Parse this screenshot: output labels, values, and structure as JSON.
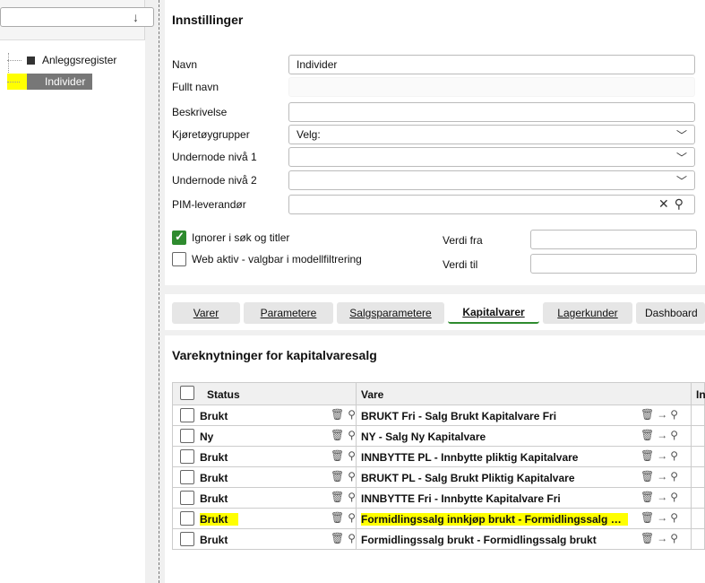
{
  "tree": {
    "search_value": "",
    "down_arrow": "↓",
    "items": [
      {
        "label": "Anleggsregister",
        "selected": false
      },
      {
        "label": "Individer",
        "selected": true
      }
    ]
  },
  "settings": {
    "title": "Innstillinger",
    "fields": [
      {
        "label": "Navn",
        "value": "Individer"
      },
      {
        "label": "Fullt navn",
        "value": ""
      },
      {
        "label": "Beskrivelse",
        "value": ""
      },
      {
        "label": "Kjøretøygrupper",
        "value": "Velg:"
      },
      {
        "label": "Undernode nivå 1",
        "value": ""
      },
      {
        "label": "Undernode nivå 2",
        "value": ""
      },
      {
        "label": "PIM-leverandør",
        "value": ""
      }
    ],
    "checkboxes": [
      {
        "label": "Ignorer i søk og titler",
        "checked": true
      },
      {
        "label": "Web aktiv - valgbar i modellfiltrering",
        "checked": false
      }
    ],
    "verdi_fra_label": "Verdi fra",
    "verdi_til_label": "Verdi til"
  },
  "tabs": [
    {
      "label": "Varer"
    },
    {
      "label": "Parametere"
    },
    {
      "label": "Salgsparametere"
    },
    {
      "label": "Kapitalvarer",
      "active": true
    },
    {
      "label": "Lagerkunder"
    },
    {
      "label": "Dashboard"
    }
  ],
  "table": {
    "title": "Vareknytninger for kapitalvaresalg",
    "headers": {
      "status": "Status",
      "vare": "Vare",
      "extra": "In"
    },
    "rows": [
      {
        "status": "Brukt",
        "vare": "BRUKT Fri - Salg Brukt Kapitalvare Fri"
      },
      {
        "status": "Ny",
        "vare": "NY - Salg Ny Kapitalvare"
      },
      {
        "status": "Brukt",
        "vare": "INNBYTTE PL - Innbytte pliktig Kapitalvare"
      },
      {
        "status": "Brukt",
        "vare": "BRUKT PL - Salg Brukt Pliktig Kapitalvare"
      },
      {
        "status": "Brukt",
        "vare": "INNBYTTE Fri - Innbytte Kapitalvare Fri"
      },
      {
        "status": "Brukt",
        "vare": "Formidlingssalg innkjøp brukt - Formidlingssalg Bru..."
      },
      {
        "status": "Brukt",
        "vare": "Formidlingssalg brukt - Formidlingssalg brukt"
      }
    ]
  },
  "colors": {
    "accent": "#2e8b2e",
    "highlight": "#ffff00"
  }
}
